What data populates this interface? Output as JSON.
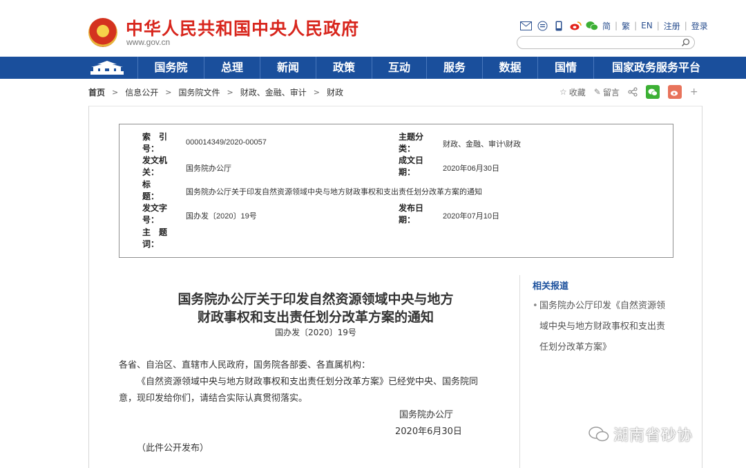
{
  "site": {
    "title": "中华人民共和国中央人民政府",
    "url": "www.gov.cn"
  },
  "toolbar": {
    "lang_simplified": "简",
    "lang_traditional": "繁",
    "lang_en": "EN",
    "register": "注册",
    "login": "登录"
  },
  "search": {
    "placeholder": ""
  },
  "nav": {
    "items": [
      "国务院",
      "总理",
      "新闻",
      "政策",
      "互动",
      "服务",
      "数据",
      "国情",
      "国家政务服务平台"
    ]
  },
  "breadcrumb": [
    "首页",
    "信息公开",
    "国务院文件",
    "财政、金融、审计",
    "财政"
  ],
  "share": {
    "favorite": "收藏",
    "comment": "留言",
    "plus": "+"
  },
  "info": {
    "index_label": [
      "索　引",
      "号："
    ],
    "index_value": "000014349/2020-00057",
    "category_label": [
      "主题分",
      "类："
    ],
    "category_value": "财政、金融、审计\\财政",
    "issuer_label": [
      "发文机",
      "关："
    ],
    "issuer_value": "国务院办公厅",
    "date_label": [
      "成文日",
      "期："
    ],
    "date_value": "2020年06月30日",
    "title_label": [
      "标　　",
      "题："
    ],
    "title_value": "国务院办公厅关于印发自然资源领域中央与地方财政事权和支出责任划分改革方案的通知",
    "docno_label": [
      "发文字",
      "号："
    ],
    "docno_value": "国办发〔2020〕19号",
    "pubdate_label": [
      "发布日",
      "期："
    ],
    "pubdate_value": "2020年07月10日",
    "keywords_label": [
      "主　题",
      "词："
    ]
  },
  "article": {
    "title_line1": "国务院办公厅关于印发自然资源领域中央与地方",
    "title_line2": "财政事权和支出责任划分改革方案的通知",
    "doc_no": "国办发〔2020〕19号",
    "salutation": "各省、自治区、直辖市人民政府，国务院各部委、各直属机构：",
    "body_line1": "《自然资源领域中央与地方财政事权和支出责任划分改革方案》已经党中央、国务院同",
    "body_line2": "意，现印发给你们，请结合实际认真贯彻落实。",
    "signature": "国务院办公厅",
    "sign_date": "2020年6月30日",
    "note": "（此件公开发布）"
  },
  "related": {
    "title": "相关报道",
    "items": [
      "国务院办公厅印发《自然资源领域中央与地方财政事权和支出责任划分改革方案》"
    ],
    "lines": [
      "国务院办公厅印发《自然资源领",
      "域中央与地方财政事权和支出责",
      "任划分改革方案》"
    ]
  },
  "watermark": "湖南省砂协",
  "colors": {
    "brand_red": "#d8261d",
    "nav_blue": "#1a4f9c",
    "link_blue": "#2a4f8f"
  }
}
